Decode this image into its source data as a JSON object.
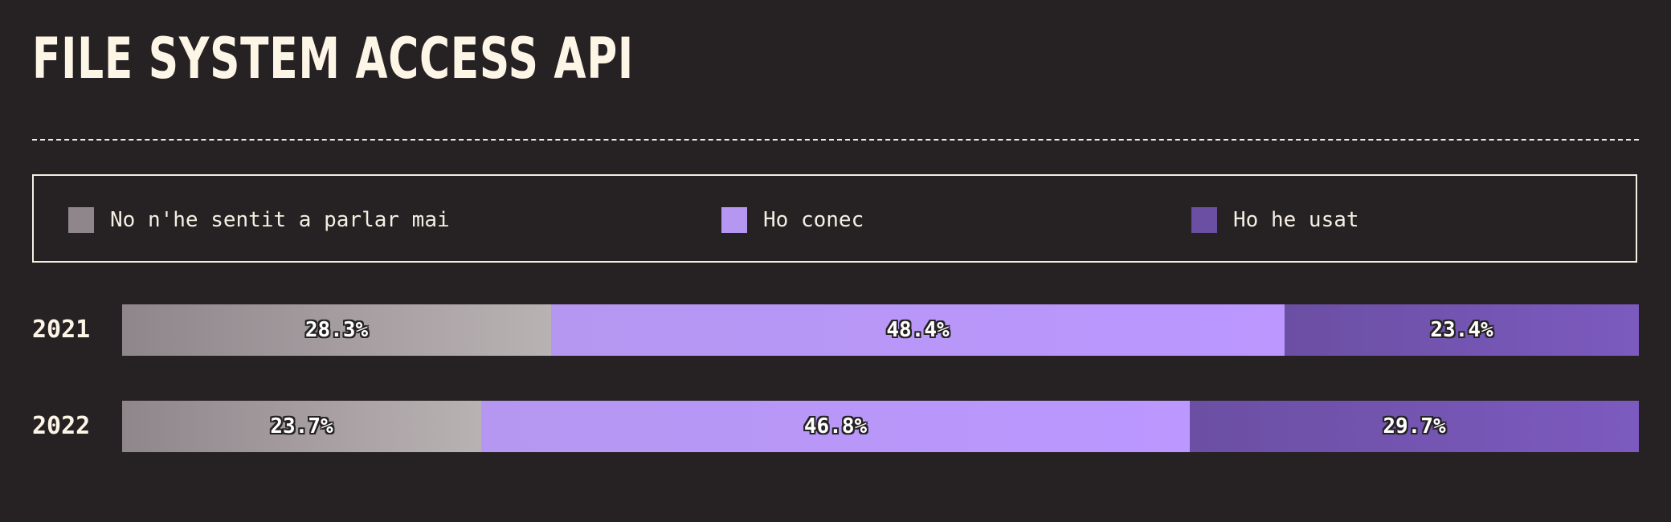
{
  "title": "FILE SYSTEM ACCESS API",
  "legend": [
    {
      "label": "No n'he sentit a parlar mai",
      "color": "#8f868b"
    },
    {
      "label": "Ho conec",
      "color": "#b597f1"
    },
    {
      "label": "Ho he usat",
      "color": "#6b4fa3"
    }
  ],
  "chart_data": {
    "type": "bar",
    "orientation": "horizontal",
    "stacked": true,
    "title": "FILE SYSTEM ACCESS API",
    "categories": [
      "2021",
      "2022"
    ],
    "series": [
      {
        "name": "No n'he sentit a parlar mai",
        "values": [
          28.3,
          23.7
        ],
        "labels": [
          "28.3%",
          "23.7%"
        ],
        "gradient": [
          "#8f868b",
          "#b9b2b3"
        ]
      },
      {
        "name": "Ho conec",
        "values": [
          48.4,
          46.8
        ],
        "labels": [
          "48.4%",
          "46.8%"
        ],
        "gradient": [
          "#b597f1",
          "#bb97ff"
        ]
      },
      {
        "name": "Ho he usat",
        "values": [
          23.4,
          29.7
        ],
        "labels": [
          "23.4%",
          "29.7%"
        ],
        "gradient": [
          "#6b4fa3",
          "#7c5abf"
        ]
      }
    ],
    "unit": "%",
    "legend_position": "top",
    "grid": false
  }
}
